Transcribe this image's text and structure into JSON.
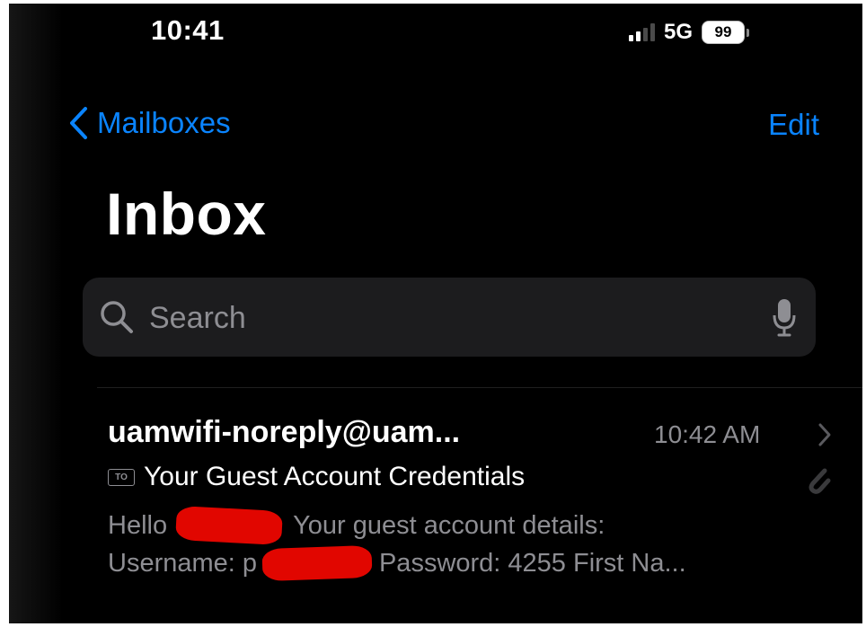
{
  "status_bar": {
    "time": "10:41",
    "network": "5G",
    "battery_percent": "99",
    "signal_bars_active": 2,
    "signal_bars_total": 4
  },
  "nav": {
    "back_label": "Mailboxes",
    "edit_label": "Edit"
  },
  "page": {
    "title": "Inbox"
  },
  "search": {
    "placeholder": "Search",
    "value": ""
  },
  "messages": [
    {
      "sender": "uamwifi-noreply@uam...",
      "time": "10:42 AM",
      "badge": "TO",
      "subject": "Your Guest Account Credentials",
      "preview_greeting": "Hello",
      "preview_line1_rest": "Your guest account details:",
      "preview_username_label": "Username:",
      "preview_username_partial": "p",
      "preview_line2_rest": "Password: 4255 First Na...",
      "has_attachment": true
    }
  ],
  "colors": {
    "background": "#000000",
    "accent": "#0a84ff",
    "text_primary": "#ffffff",
    "text_secondary": "#8e8e93",
    "search_field": "#1c1c1e",
    "redaction": "#e10600"
  },
  "icons": {
    "back": "chevron-left-icon",
    "search": "magnifier-icon",
    "mic": "microphone-icon",
    "disclosure": "chevron-right-icon",
    "attachment": "paperclip-icon"
  }
}
